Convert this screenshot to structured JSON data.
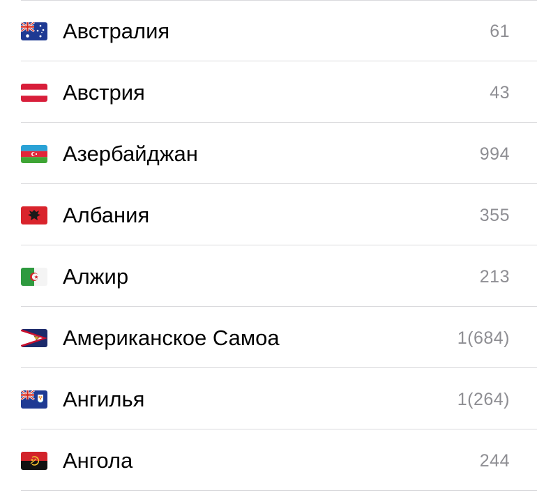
{
  "countries": [
    {
      "name": "Австралия",
      "code": "61",
      "flag_icon": "australia-flag-icon"
    },
    {
      "name": "Австрия",
      "code": "43",
      "flag_icon": "austria-flag-icon"
    },
    {
      "name": "Азербайджан",
      "code": "994",
      "flag_icon": "azerbaijan-flag-icon"
    },
    {
      "name": "Албания",
      "code": "355",
      "flag_icon": "albania-flag-icon"
    },
    {
      "name": "Алжир",
      "code": "213",
      "flag_icon": "algeria-flag-icon"
    },
    {
      "name": "Американское Самоа",
      "code": "1(684)",
      "flag_icon": "american-samoa-flag-icon"
    },
    {
      "name": "Ангилья",
      "code": "1(264)",
      "flag_icon": "anguilla-flag-icon"
    },
    {
      "name": "Ангола",
      "code": "244",
      "flag_icon": "angola-flag-icon"
    }
  ],
  "colors": {
    "text": "#000000",
    "secondary_text": "#8e8e93",
    "separator": "#d9d9dc",
    "background": "#ffffff"
  }
}
